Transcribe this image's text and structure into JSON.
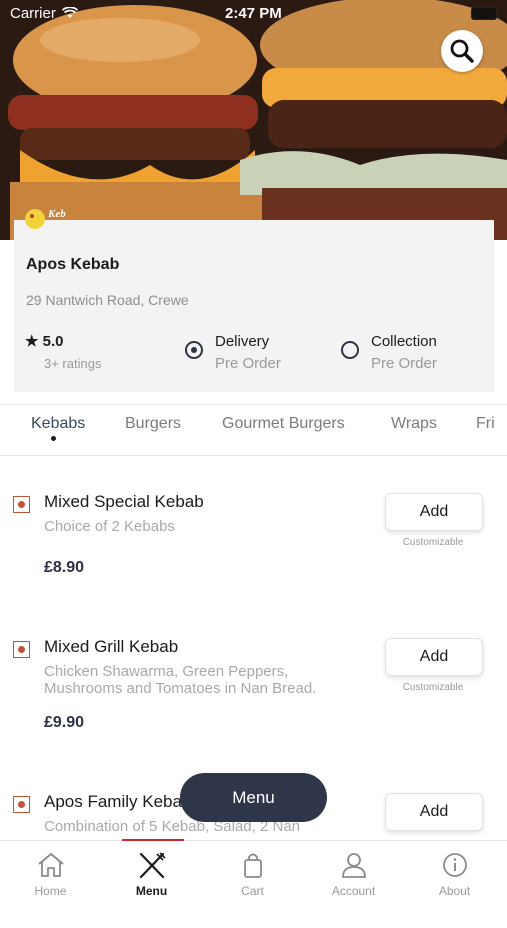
{
  "status_bar": {
    "carrier": "Carrier",
    "time": "2:47 PM"
  },
  "restaurant": {
    "name": "Apos Kebab",
    "address": "29 Nantwich Road, Crewe",
    "rating": "5.0",
    "rating_count": "3+ ratings",
    "logo_text": "Keb"
  },
  "order_options": [
    {
      "label": "Delivery",
      "sub": "Pre Order",
      "selected": true
    },
    {
      "label": "Collection",
      "sub": "Pre Order",
      "selected": false
    }
  ],
  "categories": [
    "Kebabs",
    "Burgers",
    "Gourmet Burgers",
    "Wraps",
    "Fri"
  ],
  "active_category": "Kebabs",
  "items": [
    {
      "name": "Mixed Special Kebab",
      "description": "Choice of 2 Kebabs",
      "price": "£8.90",
      "button": "Add",
      "note": "Customizable"
    },
    {
      "name": "Mixed Grill Kebab",
      "description": "Chicken Shawarma, Green Peppers, Mushrooms and Tomatoes in Nan Bread.",
      "price": "£9.90",
      "button": "Add",
      "note": "Customizable"
    },
    {
      "name": "Apos Family Kebab",
      "description": "Combination of 5 Kebab, Salad, 2 Nan",
      "price": "",
      "button": "Add",
      "note": ""
    }
  ],
  "menu_pill": "Menu",
  "bottom_nav": [
    {
      "label": "Home",
      "icon": "home-icon"
    },
    {
      "label": "Menu",
      "icon": "fork-knife-icon"
    },
    {
      "label": "Cart",
      "icon": "bag-icon"
    },
    {
      "label": "Account",
      "icon": "person-icon"
    },
    {
      "label": "About",
      "icon": "info-icon"
    }
  ],
  "colors": {
    "accent": "#d0262d",
    "dark": "#2f364a",
    "veg_marker": "#c0533a"
  }
}
